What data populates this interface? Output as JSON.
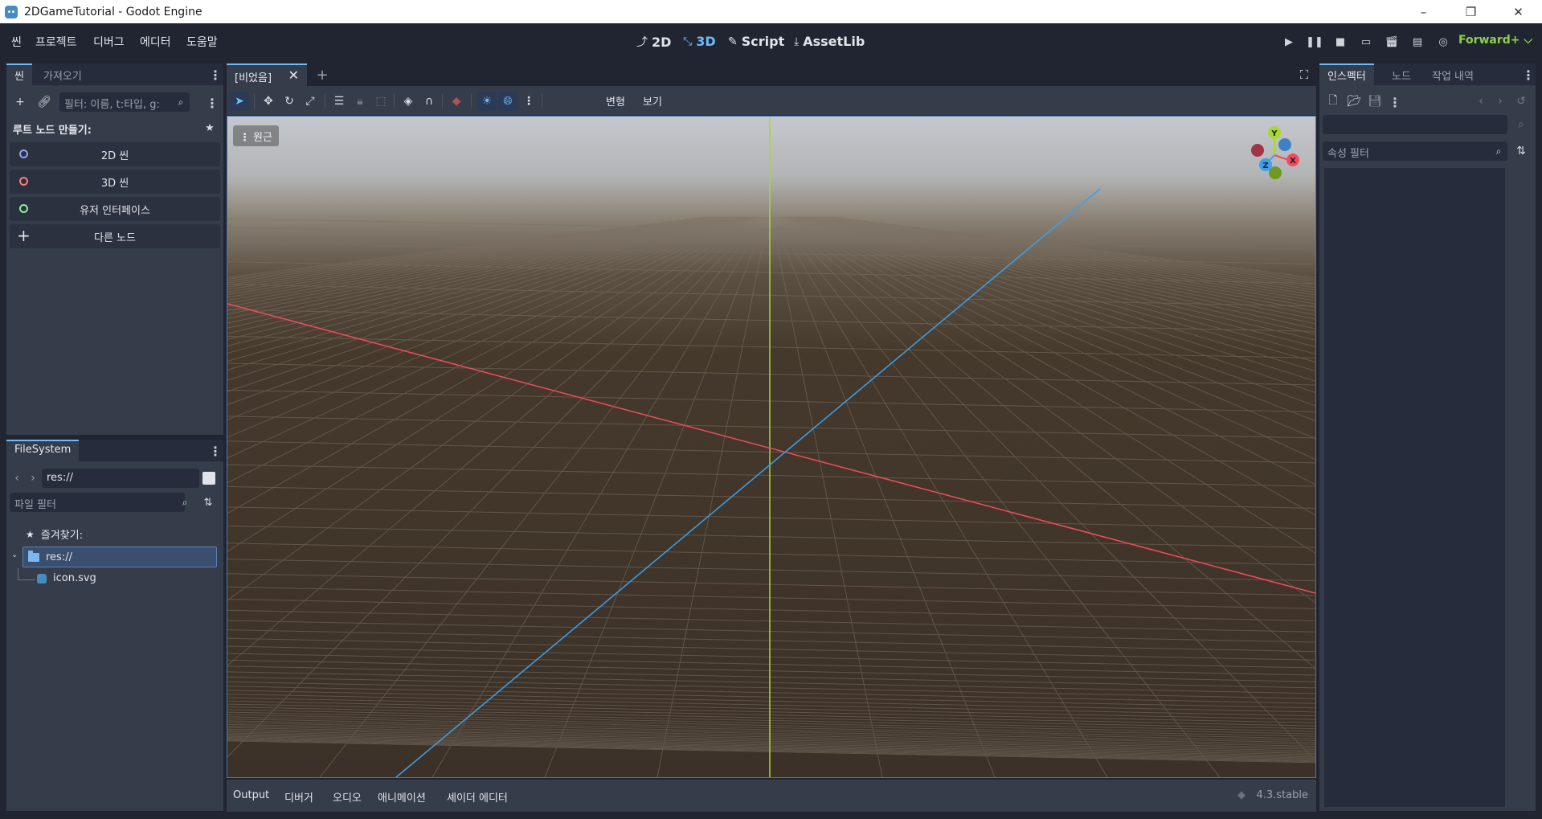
{
  "window": {
    "title": "2DGameTutorial - Godot Engine",
    "controls": [
      "–",
      "❐",
      "✕"
    ]
  },
  "menu": {
    "items": [
      "씬",
      "프로젝트",
      "디버그",
      "에디터",
      "도움말"
    ]
  },
  "workspaces": {
    "d2": "2D",
    "d3": "3D",
    "script": "Script",
    "assetlib": "AssetLib",
    "active": "3D"
  },
  "renderer": "Forward+ ⌵",
  "scene_dock": {
    "tabs": [
      "씬",
      "가져오기"
    ],
    "filter_placeholder": "필터: 이름, t:타입, g:",
    "root_label": "루트 노드 만들기:",
    "nodes": [
      {
        "label": "2D 씬",
        "color": "#8da5f3"
      },
      {
        "label": "3D 씬",
        "color": "#fc7f7f"
      },
      {
        "label": "유저 인터페이스",
        "color": "#8eef97"
      },
      {
        "label": "다른 노드",
        "color": ""
      }
    ]
  },
  "filesystem": {
    "tab": "FileSystem",
    "path": "res://",
    "filter_placeholder": "파일 필터",
    "favorites": "즐겨찾기:",
    "root": "res://",
    "files": [
      "icon.svg"
    ]
  },
  "editor": {
    "scene_tab": "[비었음]",
    "toolbar": {
      "transform": "변형",
      "view": "보기"
    },
    "perspective": "원근",
    "axis_colors": {
      "x": "#f44a5c",
      "y": "#a6d92a",
      "z": "#3aa0ef"
    }
  },
  "bottom_panel": {
    "tabs": [
      "Output",
      "디버거",
      "오디오",
      "애니메이션",
      "셰이더 에디터"
    ],
    "version": "4.3.stable"
  },
  "inspector": {
    "tabs": [
      "인스펙터",
      "노드",
      "작업 내역"
    ],
    "property_filter": "속성 필터"
  }
}
